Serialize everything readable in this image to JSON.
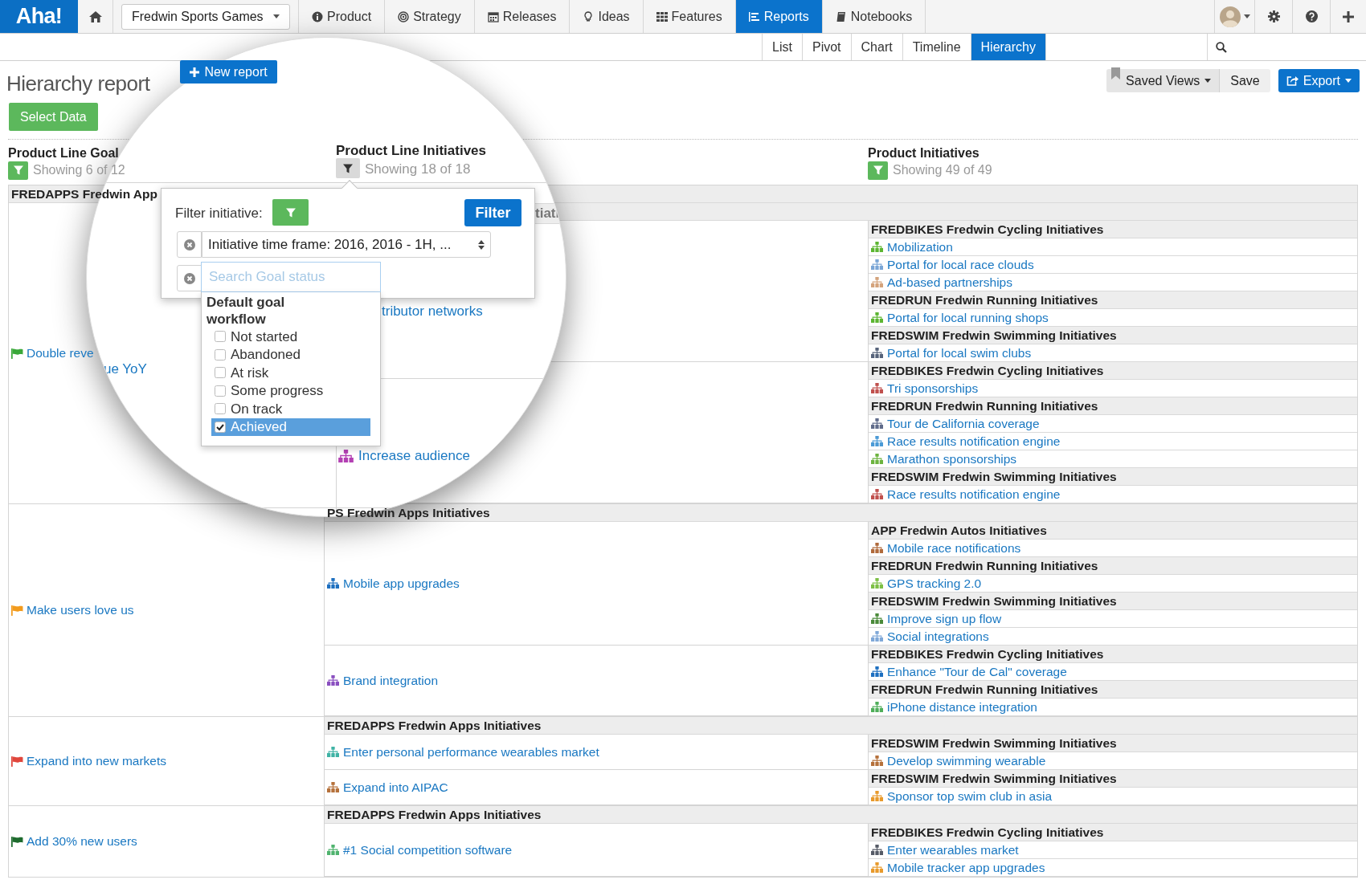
{
  "nav": {
    "logo": "Aha!",
    "product_picker": "Fredwin Sports Games",
    "items": [
      {
        "label": "Product",
        "kind": "info",
        "selected": false
      },
      {
        "label": "Strategy",
        "kind": "target",
        "selected": false
      },
      {
        "label": "Releases",
        "kind": "calendar",
        "selected": false
      },
      {
        "label": "Ideas",
        "kind": "bulb",
        "selected": false
      },
      {
        "label": "Features",
        "kind": "grid",
        "selected": false
      },
      {
        "label": "Reports",
        "kind": "report",
        "selected": true
      },
      {
        "label": "Notebooks",
        "kind": "book",
        "selected": false
      }
    ]
  },
  "report_tabs": [
    {
      "label": "List",
      "selected": false
    },
    {
      "label": "Pivot",
      "selected": false
    },
    {
      "label": "Chart",
      "selected": false
    },
    {
      "label": "Timeline",
      "selected": false
    },
    {
      "label": "Hierarchy",
      "selected": true
    }
  ],
  "page": {
    "title": "Hierarchy report",
    "new_report": "New report",
    "saved_views": "Saved Views",
    "save": "Save",
    "export": "Export",
    "select_data": "Select Data"
  },
  "column_headers": [
    {
      "title": "Product Line Goal",
      "showing": "Showing 6 of 12",
      "filtered": true
    },
    {
      "title": "Product Initiatives",
      "showing": "Showing 49 of 49",
      "filtered": true
    }
  ],
  "table": {
    "product_line": "FREDAPPS Fredwin App",
    "goals": [
      {
        "name": "Double reve",
        "color": "#3aa83a",
        "initiatives": [
          {
            "groups": [
              {
                "header": "FREDBIKES Fredwin Cycling Initiatives",
                "items": [
                  {
                    "name": "Mobilization",
                    "color": "#5cb531"
                  },
                  {
                    "name": "Portal for local race clouds",
                    "color": "#7aa6d6"
                  },
                  {
                    "name": "Ad-based partnerships",
                    "color": "#d4a37c"
                  }
                ]
              },
              {
                "header": "FREDRUN Fredwin Running Initiatives",
                "items": [
                  {
                    "name": "Portal for local running shops",
                    "color": "#5cb531"
                  }
                ]
              },
              {
                "header": "FREDSWIM Fredwin Swimming Initiatives",
                "items": [
                  {
                    "name": "Portal for local swim clubs",
                    "color": "#56637a"
                  }
                ]
              }
            ]
          },
          {
            "groups": [
              {
                "header": "FREDBIKES Fredwin Cycling Initiatives",
                "items": [
                  {
                    "name": "Tri sponsorships",
                    "color": "#c0504d"
                  }
                ]
              },
              {
                "header": "FREDRUN Fredwin Running Initiatives",
                "items": [
                  {
                    "name": "Tour de California coverage",
                    "color": "#5f6b8a"
                  },
                  {
                    "name": "Race results notification engine",
                    "color": "#4a9ad6"
                  },
                  {
                    "name": "Marathon sponsorships",
                    "color": "#6cb33f"
                  }
                ]
              },
              {
                "header": "FREDSWIM Fredwin Swimming Initiatives",
                "items": [
                  {
                    "name": "Race results notification engine",
                    "color": "#c0504d"
                  }
                ]
              }
            ]
          }
        ]
      },
      {
        "name": "Make users love us",
        "color": "#f29b1d",
        "header": "PS Fredwin Apps Initiatives",
        "initiatives": [
          {
            "name": "Mobile app upgrades",
            "color": "#1d6fc0",
            "groups": [
              {
                "header": "APP Fredwin Autos Initiatives",
                "items": [
                  {
                    "name": "Mobile race notifications",
                    "color": "#b06a3b"
                  }
                ]
              },
              {
                "header": "FREDRUN Fredwin Running Initiatives",
                "items": [
                  {
                    "name": "GPS tracking 2.0",
                    "color": "#7cbf45"
                  }
                ]
              },
              {
                "header": "FREDSWIM Fredwin Swimming Initiatives",
                "items": [
                  {
                    "name": "Improve sign up flow",
                    "color": "#4a8a3a"
                  },
                  {
                    "name": "Social integrations",
                    "color": "#7fa8d8"
                  }
                ]
              }
            ]
          },
          {
            "name": "Brand integration",
            "color": "#8a4fc0",
            "groups": [
              {
                "header": "FREDBIKES Fredwin Cycling Initiatives",
                "items": [
                  {
                    "name": "Enhance \"Tour de Cal\" coverage",
                    "color": "#1d6fc0"
                  }
                ]
              },
              {
                "header": "FREDRUN Fredwin Running Initiatives",
                "items": [
                  {
                    "name": "iPhone distance integration",
                    "color": "#4fae5a"
                  }
                ]
              }
            ]
          }
        ]
      },
      {
        "name": "Expand into new markets",
        "color": "#e0463c",
        "header": "FREDAPPS Fredwin Apps Initiatives",
        "initiatives": [
          {
            "name": "Enter personal performance wearables market",
            "color": "#3fb3a5",
            "groups": [
              {
                "header": "FREDSWIM Fredwin Swimming Initiatives",
                "items": [
                  {
                    "name": "Develop swimming wearable",
                    "color": "#b5713b"
                  }
                ]
              }
            ]
          },
          {
            "name": "Expand into AIPAC",
            "color": "#b5713b",
            "groups": [
              {
                "header": "FREDSWIM Fredwin Swimming Initiatives",
                "items": [
                  {
                    "name": "Sponsor top swim club in asia",
                    "color": "#e89a2c"
                  }
                ]
              }
            ]
          }
        ]
      },
      {
        "name": "Add 30% new users",
        "color": "#1e6b2e",
        "header": "FREDAPPS Fredwin Apps Initiatives",
        "initiatives": [
          {
            "name": "#1 Social competition software",
            "color": "#4fb36e",
            "groups": [
              {
                "header": "FREDBIKES Fredwin Cycling Initiatives",
                "items": [
                  {
                    "name": "Enter wearables market",
                    "color": "#555a66"
                  },
                  {
                    "name": "Mobile tracker app upgrades",
                    "color": "#e89a2c"
                  }
                ]
              }
            ]
          }
        ]
      }
    ]
  },
  "magnifier": {
    "column_title": "Product Line Initiatives",
    "showing": "Showing 18 of 18",
    "filtered": false,
    "popover": {
      "label": "Filter initiative:",
      "button": "Filter",
      "select_value": "Initiative time frame: 2016, 2016 - 1H, ...",
      "search_placeholder": "Search Goal status",
      "group": "Default goal workflow",
      "options": [
        {
          "label": "Not started",
          "checked": false,
          "selected": false
        },
        {
          "label": "Abandoned",
          "checked": false,
          "selected": false
        },
        {
          "label": "At risk",
          "checked": false,
          "selected": false
        },
        {
          "label": "Some progress",
          "checked": false,
          "selected": false
        },
        {
          "label": "On track",
          "checked": false,
          "selected": false
        },
        {
          "label": "Achieved",
          "checked": true,
          "selected": true
        }
      ]
    },
    "fragments": [
      {
        "kind": "header",
        "text": "tiati"
      },
      {
        "kind": "link",
        "text": "tributor networks"
      },
      {
        "kind": "link",
        "text": "ue YoY"
      },
      {
        "kind": "initiative",
        "text": "Increase audience",
        "color": "#b340b3"
      }
    ]
  }
}
